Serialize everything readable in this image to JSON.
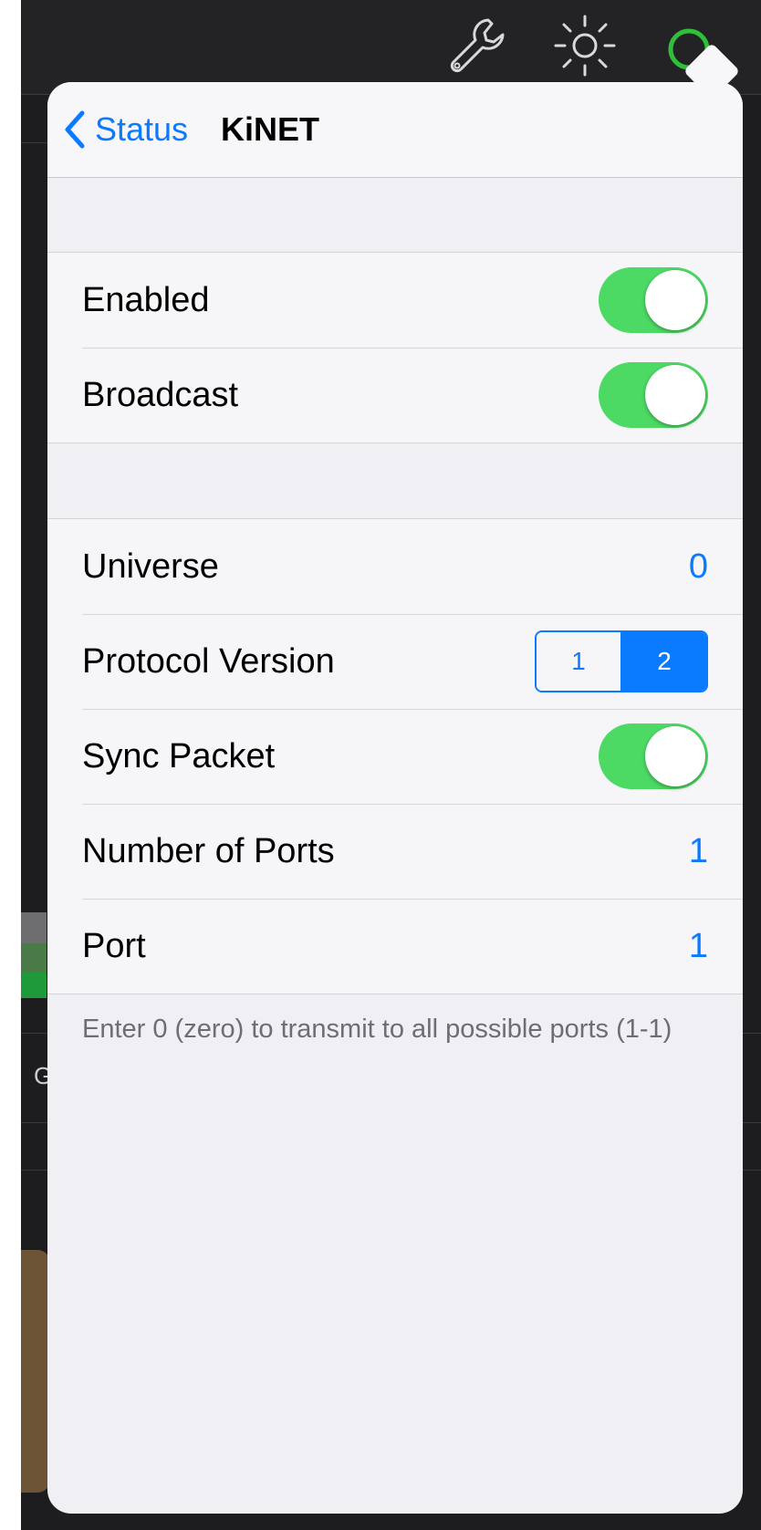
{
  "colors": {
    "accent": "#0a7aff",
    "switch_on": "#4cd964",
    "status_ring": "#2fbf3a"
  },
  "toolbar": {
    "icons": [
      "wrench-icon",
      "sun-icon",
      "status-ring-icon"
    ]
  },
  "navbar": {
    "back_label": "Status",
    "title": "KiNET"
  },
  "section1": {
    "enabled_label": "Enabled",
    "enabled_on": true,
    "broadcast_label": "Broadcast",
    "broadcast_on": true
  },
  "section2": {
    "universe_label": "Universe",
    "universe_value": "0",
    "protocol_label": "Protocol Version",
    "protocol_options": [
      "1",
      "2"
    ],
    "protocol_selected": "2",
    "sync_label": "Sync Packet",
    "sync_on": true,
    "ports_label": "Number of Ports",
    "ports_value": "1",
    "port_label": "Port",
    "port_value": "1"
  },
  "footer": {
    "note": "Enter 0 (zero) to transmit to all possible ports (1-1)"
  }
}
